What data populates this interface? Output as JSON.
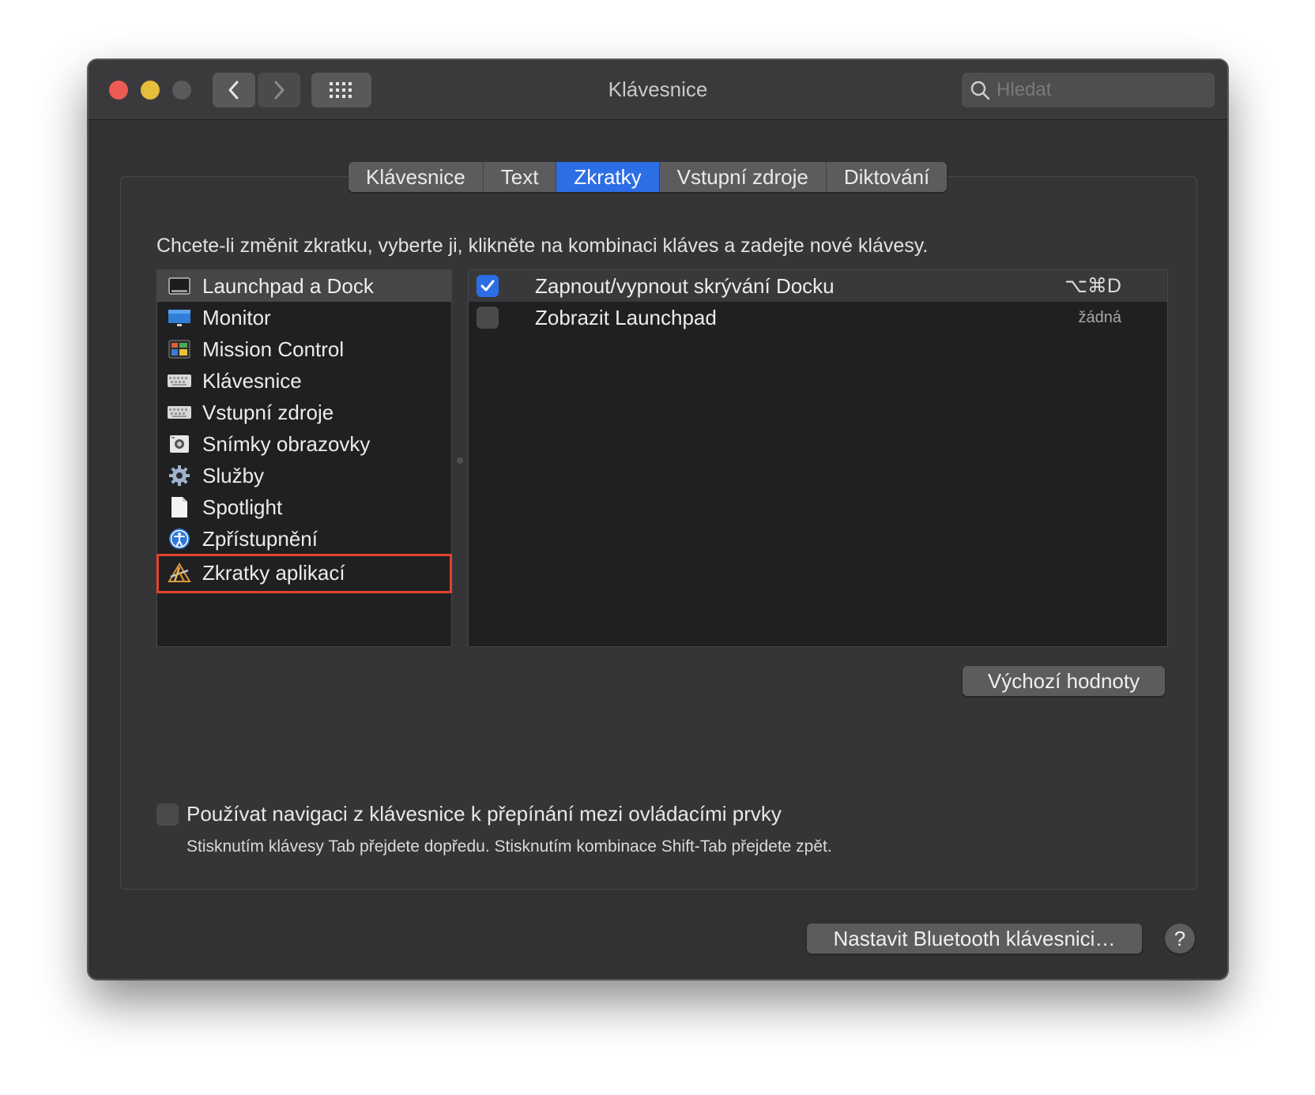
{
  "window": {
    "title": "Klávesnice",
    "search": {
      "placeholder": "Hledat",
      "value": ""
    }
  },
  "tabs": [
    {
      "label": "Klávesnice",
      "active": false
    },
    {
      "label": "Text",
      "active": false
    },
    {
      "label": "Zkratky",
      "active": true
    },
    {
      "label": "Vstupní zdroje",
      "active": false
    },
    {
      "label": "Diktování",
      "active": false
    }
  ],
  "instruction": "Chcete-li změnit zkratku, vyberte ji, klikněte na kombinaci kláves a zadejte nové klávesy.",
  "categories": [
    {
      "label": "Launchpad a Dock",
      "icon": "launchpad-dock-icon",
      "selected": true
    },
    {
      "label": "Monitor",
      "icon": "monitor-icon",
      "selected": false
    },
    {
      "label": "Mission Control",
      "icon": "mission-control-icon",
      "selected": false
    },
    {
      "label": "Klávesnice",
      "icon": "keyboard-icon",
      "selected": false
    },
    {
      "label": "Vstupní zdroje",
      "icon": "input-sources-icon",
      "selected": false
    },
    {
      "label": "Snímky obrazovky",
      "icon": "screenshot-icon",
      "selected": false
    },
    {
      "label": "Služby",
      "icon": "gear-icon",
      "selected": false
    },
    {
      "label": "Spotlight",
      "icon": "document-icon",
      "selected": false
    },
    {
      "label": "Zpřístupnění",
      "icon": "accessibility-icon",
      "selected": false
    },
    {
      "label": "Zkratky aplikací",
      "icon": "app-shortcuts-icon",
      "selected": false,
      "highlighted": true
    }
  ],
  "shortcuts": [
    {
      "label": "Zapnout/vypnout skrývání Docku",
      "keys": "⌥⌘D",
      "checked": true,
      "selected": true
    },
    {
      "label": "Zobrazit Launchpad",
      "keys": "žádná",
      "checked": false,
      "selected": false
    }
  ],
  "buttons": {
    "defaults": "Výchozí hodnoty",
    "bluetooth": "Nastavit Bluetooth klávesnici…",
    "help": "?"
  },
  "keyboard_navigation": {
    "label": "Používat navigaci z klávesnice k přepínání mezi ovládacími prvky",
    "hint": "Stisknutím klávesy Tab přejdete dopředu. Stisknutím kombinace Shift-Tab přejdete zpět.",
    "checked": false
  },
  "colors": {
    "accent": "#2c6ee6",
    "highlight_box": "#e2432d",
    "close": "#ec5b55",
    "minimize": "#e6bd3c"
  }
}
